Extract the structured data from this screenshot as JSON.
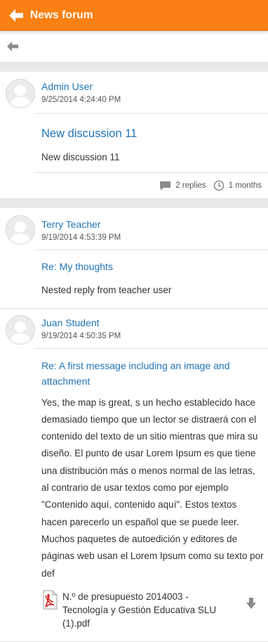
{
  "header": {
    "title": "News forum",
    "back_icon": "arrow-left-icon"
  },
  "subbar": {
    "back_icon": "arrow-left-icon"
  },
  "discussion": {
    "author": "Admin User",
    "date": "9/25/2014 4:24:40 PM",
    "subject": "New discussion 11",
    "message": "New discussion 11",
    "replies": "2 replies",
    "time_ago": "1 months"
  },
  "posts": [
    {
      "author": "Terry Teacher",
      "date": "9/19/2014 4:53:39 PM",
      "subject": "Re: My thoughts",
      "message": "Nested reply from teacher user"
    },
    {
      "author": "Juan Student",
      "date": "9/19/2014 4:50:35 PM",
      "subject": "Re: A first message including an image and attachment",
      "message": "Yes, the map is great, s un hecho establecido hace demasiado tiempo que un lector se distraerá con el contenido del texto de un sitio mientras que mira su diseño. El punto de usar Lorem Ipsum es que tiene una distribución más o menos normal de las letras, al contrario de usar textos como por ejemplo \"Contenido aquí, contenido aquí\". Estos textos hacen parecerlo un español que se puede leer. Muchos paquetes de autoedición y editores de páginas web usan el Lorem Ipsum como su texto por def",
      "attachment": "N.º de presupuesto 2014003 - Tecnología y Gestión Educativa SLU (1).pdf"
    }
  ],
  "colors": {
    "header": "#f98012",
    "link": "#1f75b8",
    "gap": "#e9e9e9"
  }
}
